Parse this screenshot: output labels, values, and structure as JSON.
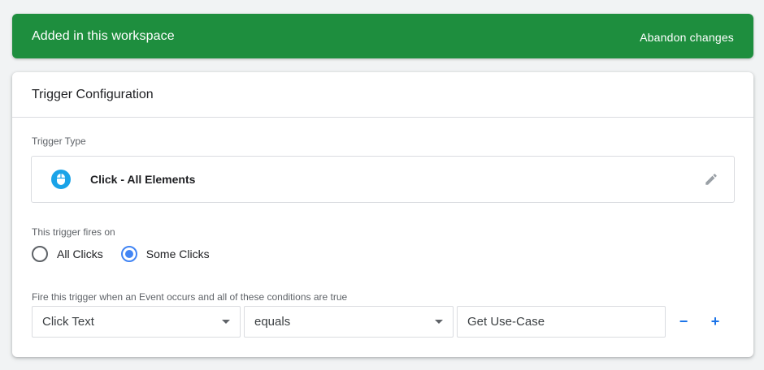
{
  "banner": {
    "title": "Added in this workspace",
    "action_label": "Abandon changes",
    "color": "#1e8e3e"
  },
  "card": {
    "title": "Trigger Configuration",
    "trigger_type_label": "Trigger Type",
    "trigger_type": {
      "name": "Click - All Elements",
      "icon": "mouse-icon",
      "edit_icon": "pencil-icon"
    },
    "fires_on_label": "This trigger fires on",
    "fires_on_options": [
      {
        "label": "All Clicks",
        "selected": false
      },
      {
        "label": "Some Clicks",
        "selected": true
      }
    ],
    "condition_label": "Fire this trigger when an Event occurs and all of these conditions are true",
    "condition": {
      "variable": "Click Text",
      "operator": "equals",
      "value": "Get Use-Case",
      "remove_label": "−",
      "add_label": "+"
    }
  },
  "colors": {
    "accent": "#1a73e8",
    "radio_selected": "#4285f4",
    "icon_blue": "#1aa3e8"
  }
}
